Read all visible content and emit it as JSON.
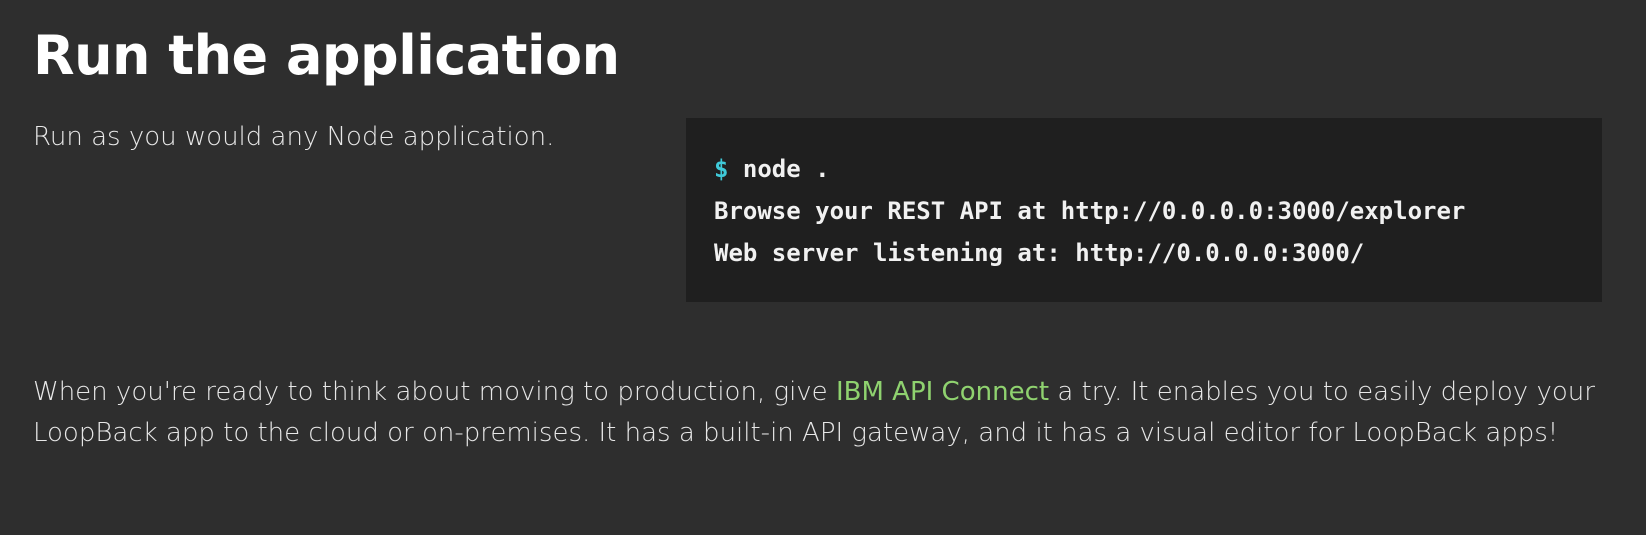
{
  "section": {
    "title": "Run the application",
    "intro": "Run as you would any Node application."
  },
  "code": {
    "prompt": "$",
    "command": " node .",
    "lines": [
      "Browse your REST API at http://0.0.0.0:3000/explorer",
      "Web server listening at: http://0.0.0.0:3000/"
    ]
  },
  "production": {
    "text_before": "When you're ready to think about moving to production, give ",
    "link_text": "IBM API Connect",
    "text_after": " a try. It enables you to easily deploy your LoopBack app to the cloud or on-premises. It has a built-in API gateway, and it has a visual editor for LoopBack apps!"
  },
  "colors": {
    "background": "#2e2e2e",
    "code_background": "#1f1f1f",
    "prompt": "#3fc9d8",
    "link": "#8fd26f"
  }
}
